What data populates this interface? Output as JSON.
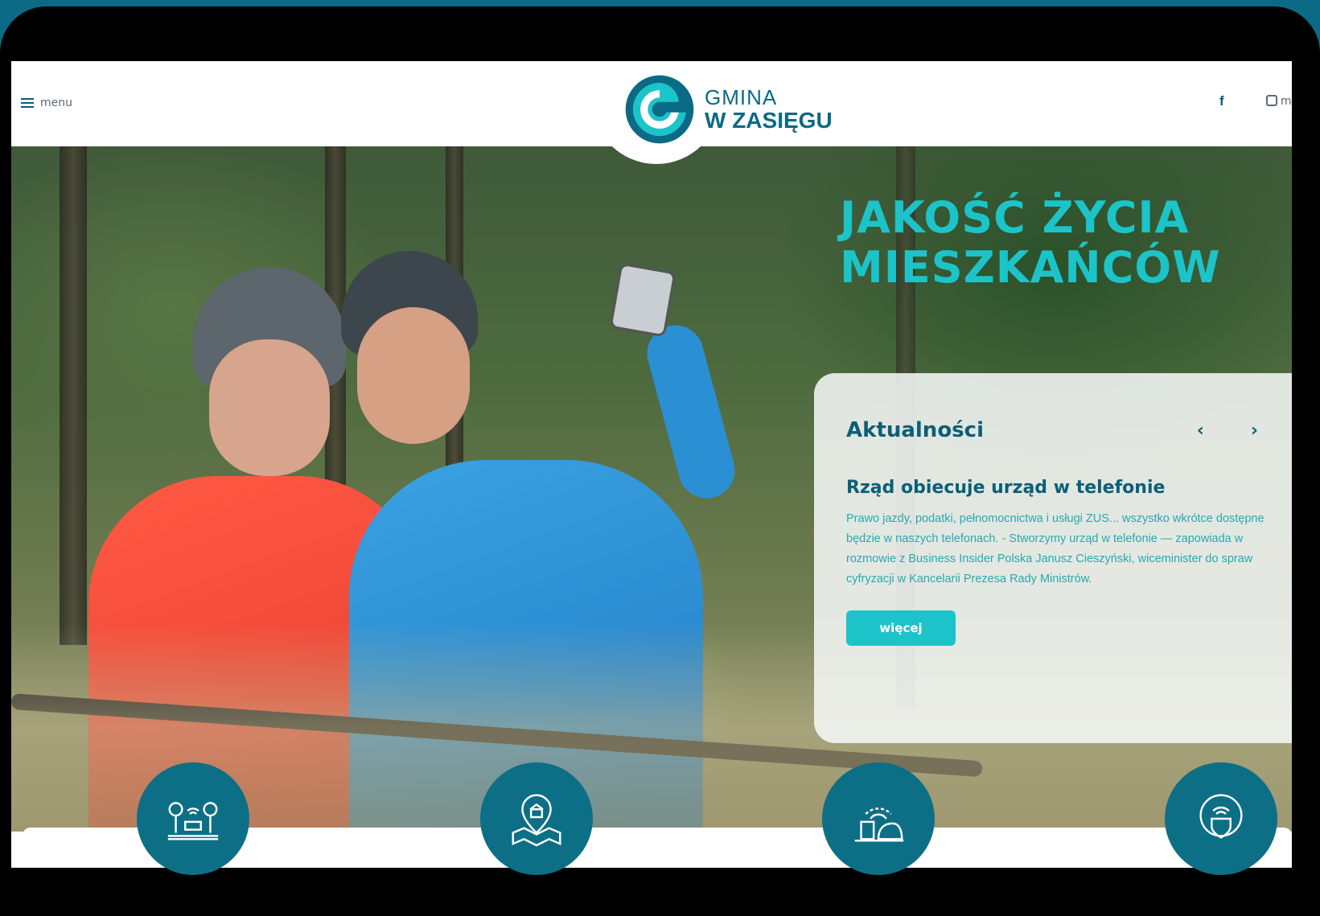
{
  "header": {
    "menu_label": "menu",
    "logo_line1": "GMINA",
    "logo_line2": "W ZASIĘGU",
    "facebook_label": "f",
    "other_label": "m"
  },
  "hero": {
    "headline_line1": "JAKOŚĆ ŻYCIA",
    "headline_line2": "MIESZKAŃCÓW"
  },
  "news": {
    "section_title": "Aktualności",
    "prev_arrow": "‹",
    "next_arrow": "›",
    "article_title": "Rząd obiecuje urząd w telefonie",
    "article_text": "Prawo jazdy, podatki, pełnomocnictwa i usługi ZUS... wszystko wkrótce dostępne będzie w naszych telefonach. - Stworzymy urząd w telefonie — zapowiada w rozmowie z Business Insider Polska Janusz Cieszyński, wiceminister do spraw cyfryzacji w Kancelarii Prezesa Rady Ministrów.",
    "more_label": "więcej"
  },
  "icons": [
    "park-wifi-icon",
    "town-hall-map-icon",
    "city-wifi-icon",
    "wifi-shield-icon"
  ],
  "colors": {
    "brand_dark": "#0b6a86",
    "accent_teal": "#1cc4c9",
    "circle_bg": "#0d6f86"
  }
}
